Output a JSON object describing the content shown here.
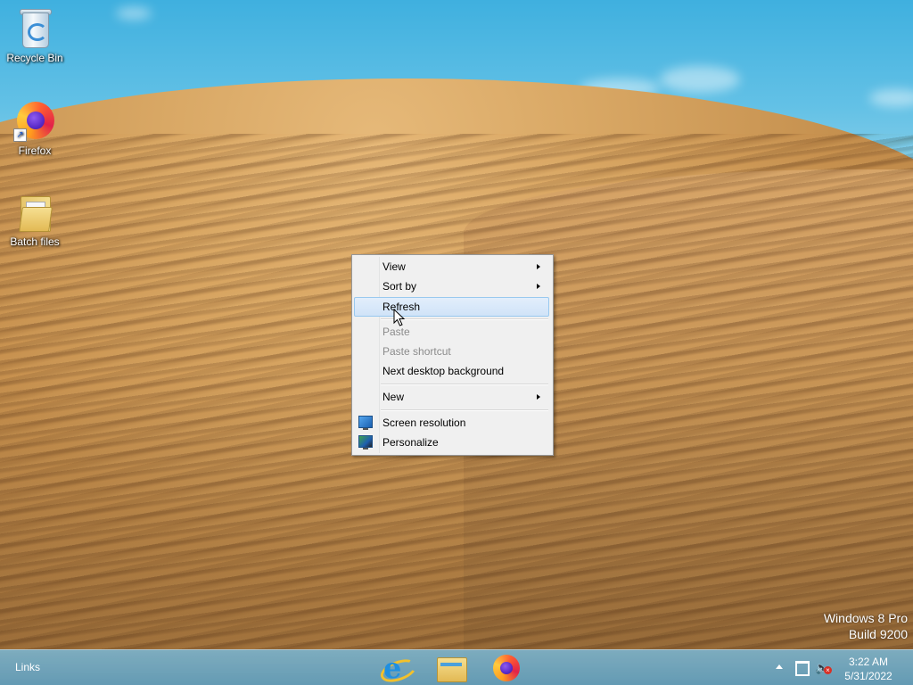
{
  "desktop": {
    "icons": [
      {
        "label": "Recycle Bin",
        "icon": "recycle-bin-icon"
      },
      {
        "label": "Firefox",
        "icon": "firefox-icon"
      },
      {
        "label": "Batch files",
        "icon": "folder-icon"
      }
    ]
  },
  "context_menu": {
    "items": [
      {
        "label": "View",
        "submenu": true
      },
      {
        "label": "Sort by",
        "submenu": true
      },
      {
        "label": "Refresh",
        "highlighted": true
      },
      {
        "label": "Paste",
        "disabled": true
      },
      {
        "label": "Paste shortcut",
        "disabled": true
      },
      {
        "label": "Next desktop background"
      },
      {
        "label": "New",
        "submenu": true
      },
      {
        "label": "Screen resolution",
        "icon": "screen-resolution-icon"
      },
      {
        "label": "Personalize",
        "icon": "personalize-icon"
      }
    ]
  },
  "watermark": {
    "line1": "Windows 8 Pro",
    "line2": "Build 9200"
  },
  "taskbar": {
    "links_label": "Links",
    "pinned": [
      {
        "name": "Internet Explorer",
        "icon": "internet-explorer-icon"
      },
      {
        "name": "File Explorer",
        "icon": "file-explorer-icon"
      },
      {
        "name": "Firefox",
        "icon": "firefox-icon"
      }
    ],
    "clock": {
      "time": "3:22 AM",
      "date": "5/31/2022"
    }
  },
  "colors": {
    "menu_bg": "#f0f0f0",
    "menu_highlight": "#d0e3f8",
    "menu_disabled_text": "#8b8b8b",
    "taskbar": "#6ea9c6"
  }
}
